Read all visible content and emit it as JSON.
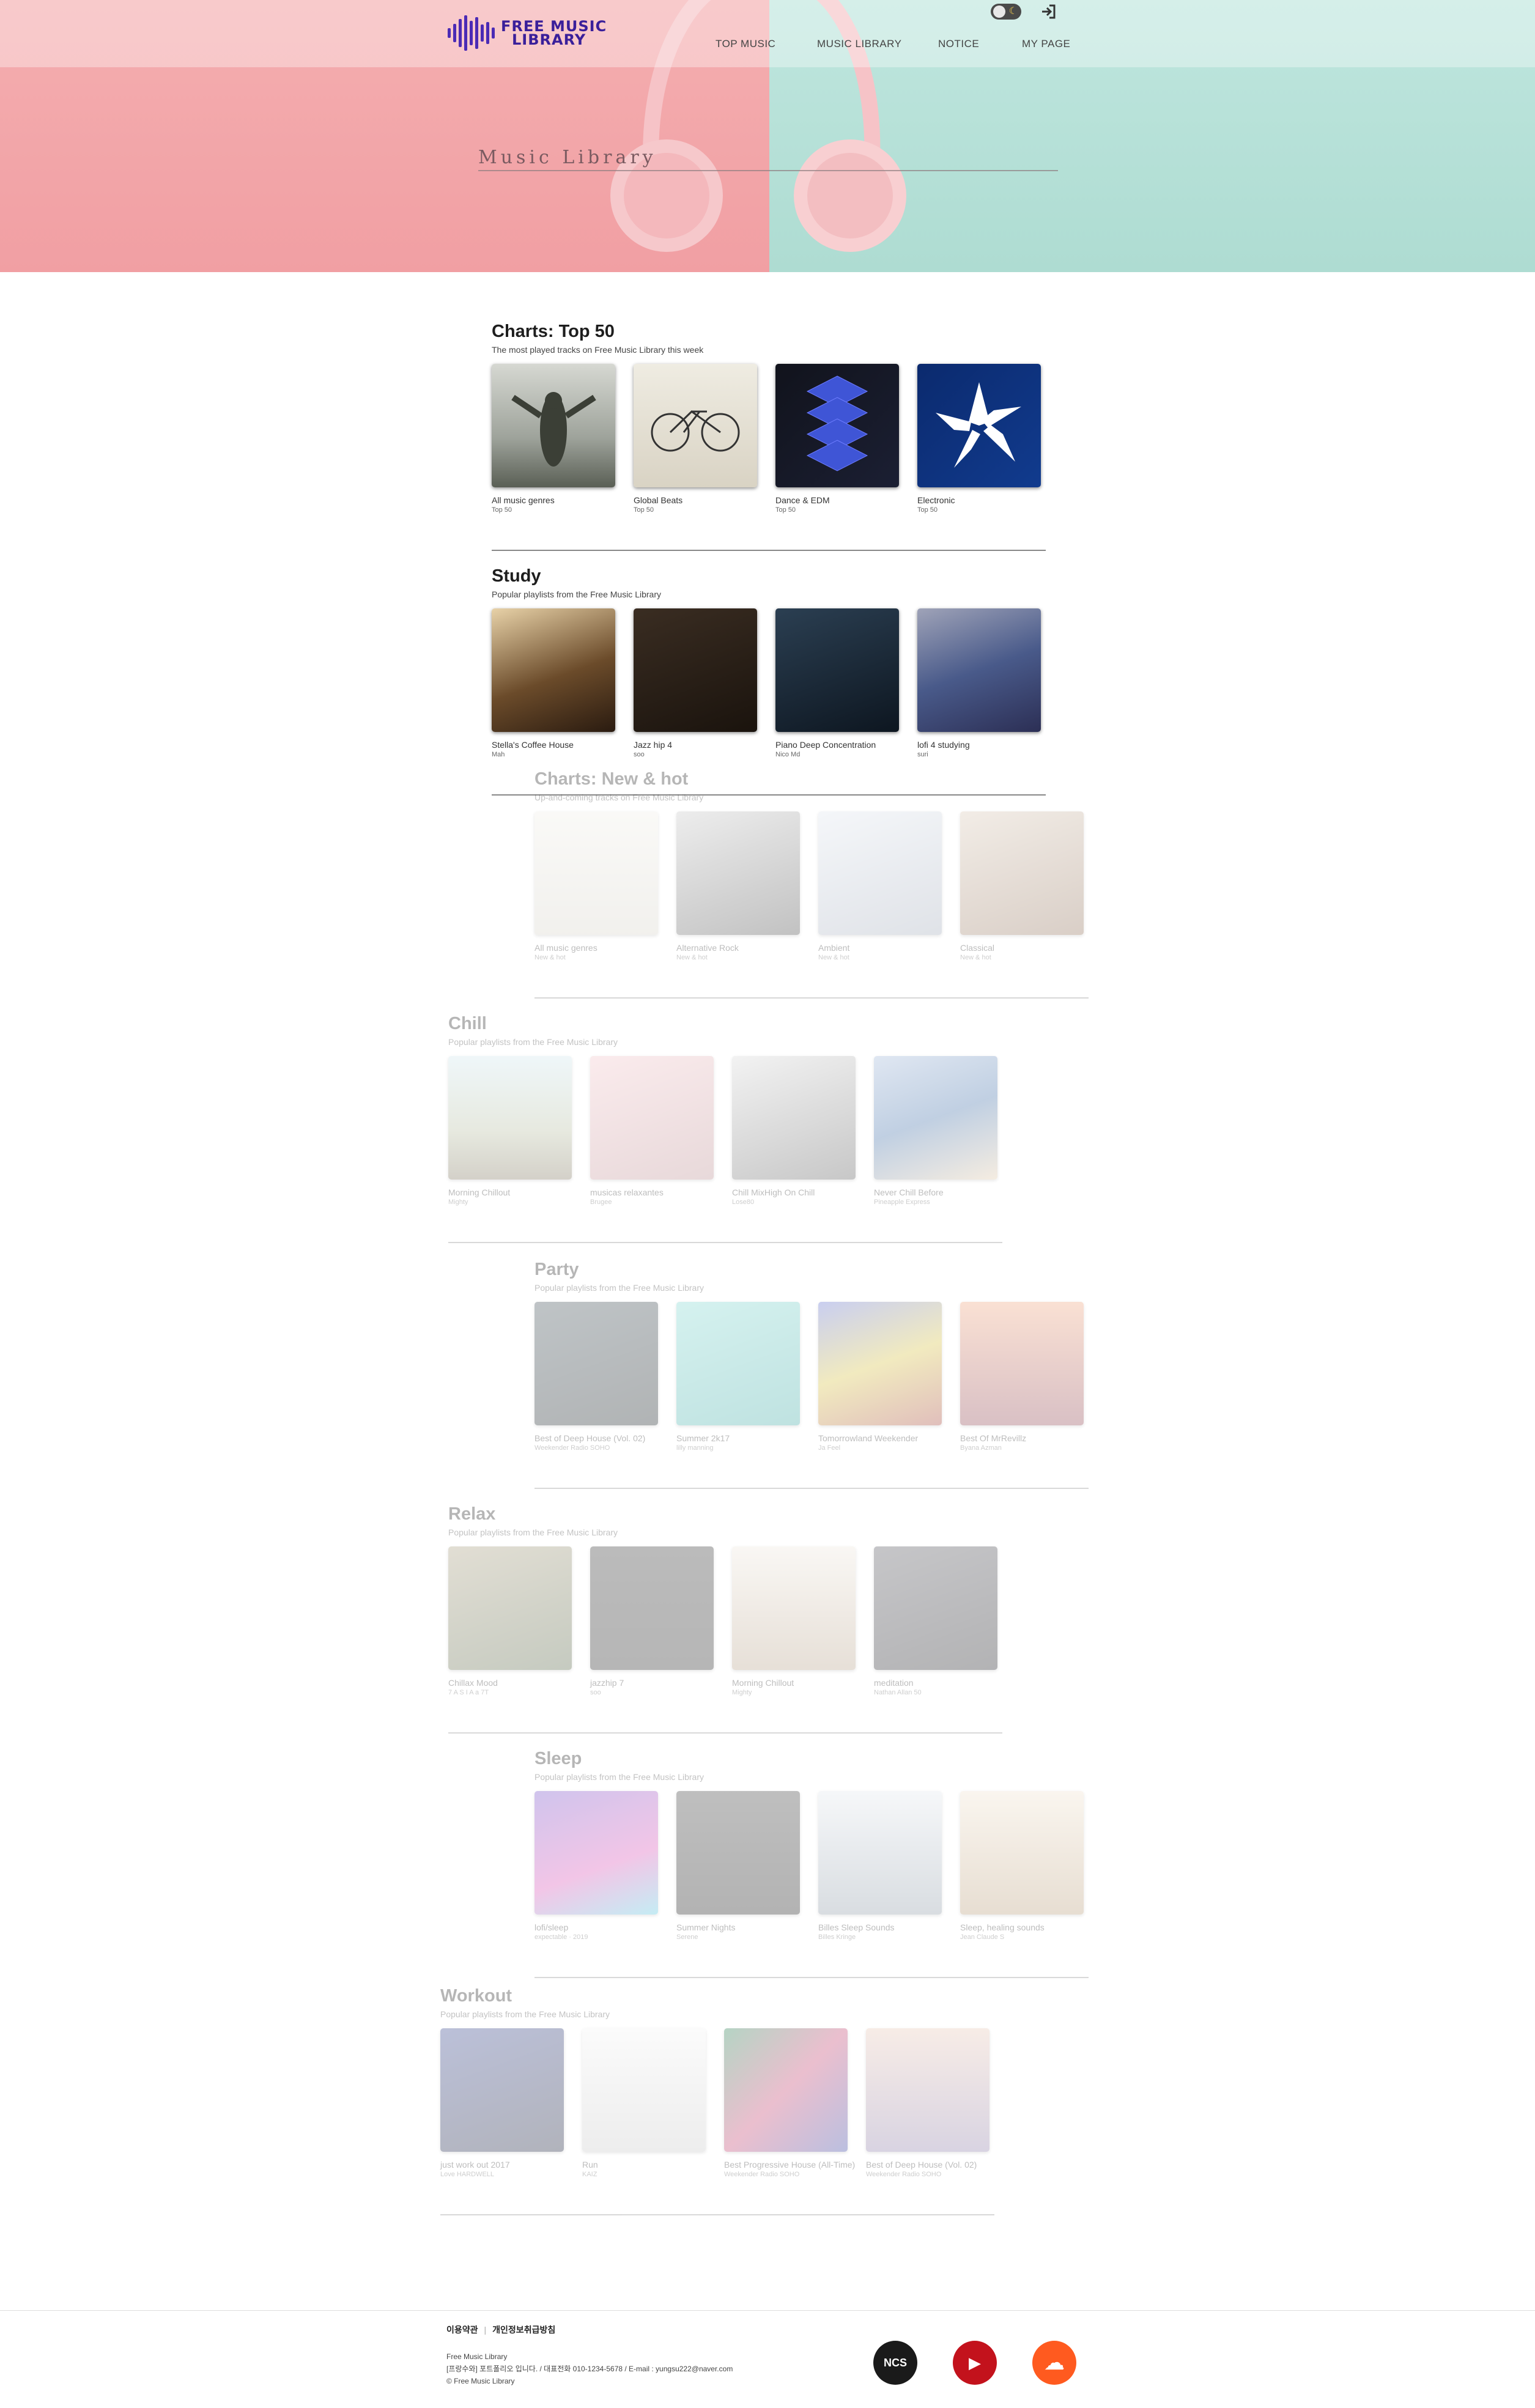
{
  "header": {
    "logo_line1": "FREE MUSIC",
    "logo_line2": "LIBRARY",
    "nav": [
      "TOP MUSIC",
      "MUSIC LIBRARY",
      "NOTICE",
      "MY PAGE"
    ]
  },
  "hero": {
    "title": "Music Library"
  },
  "sections": [
    {
      "title": "Charts: Top 50",
      "subtitle": "The most played tracks on Free Music Library this week",
      "items": [
        {
          "title": "All music genres",
          "sub": "Top 50"
        },
        {
          "title": "Global Beats",
          "sub": "Top 50"
        },
        {
          "title": "Dance & EDM",
          "sub": "Top 50"
        },
        {
          "title": "Electronic",
          "sub": "Top 50"
        }
      ]
    },
    {
      "title": "Study",
      "subtitle": "Popular playlists from the Free Music Library",
      "items": [
        {
          "title": "Stella's Coffee House",
          "sub": "Mah"
        },
        {
          "title": "Jazz hip 4",
          "sub": "soo"
        },
        {
          "title": "Piano Deep Concentration",
          "sub": "Nico Md"
        },
        {
          "title": "lofi 4 studying",
          "sub": "suri"
        }
      ]
    },
    {
      "title": "Charts: New & hot",
      "subtitle": "Up-and-coming tracks on Free Music Library",
      "items": [
        {
          "title": "All music genres",
          "sub": "New & hot"
        },
        {
          "title": "Alternative Rock",
          "sub": "New & hot"
        },
        {
          "title": "Ambient",
          "sub": "New & hot"
        },
        {
          "title": "Classical",
          "sub": "New & hot"
        }
      ]
    },
    {
      "title": "Chill",
      "subtitle": "Popular playlists from the Free Music Library",
      "items": [
        {
          "title": "Morning Chillout",
          "sub": "Mighty"
        },
        {
          "title": "musicas relaxantes",
          "sub": "Brugee"
        },
        {
          "title": "Chill MixHigh On Chill",
          "sub": "Lose80"
        },
        {
          "title": "Never Chill Before",
          "sub": "Pineapple Express"
        }
      ]
    },
    {
      "title": "Party",
      "subtitle": "Popular playlists from the Free Music Library",
      "items": [
        {
          "title": "Best of Deep House (Vol. 02)",
          "sub": "Weekender Radio SOHO"
        },
        {
          "title": "Summer 2k17",
          "sub": "lilly manning"
        },
        {
          "title": "Tomorrowland Weekender",
          "sub": "Ja Feel"
        },
        {
          "title": "Best Of MrRevillz",
          "sub": "Byana Azman"
        }
      ]
    },
    {
      "title": "Relax",
      "subtitle": "Popular playlists from the Free Music Library",
      "items": [
        {
          "title": "Chillax Mood",
          "sub": "7 A S I A a 7T"
        },
        {
          "title": "jazzhip 7",
          "sub": "soo"
        },
        {
          "title": "Morning Chillout",
          "sub": "Mighty"
        },
        {
          "title": "meditation",
          "sub": "Nathan Allan 50"
        }
      ]
    },
    {
      "title": "Sleep",
      "subtitle": "Popular playlists from the Free Music Library",
      "items": [
        {
          "title": "lofi/sleep",
          "sub": "expectable · 2019"
        },
        {
          "title": "Summer Nights",
          "sub": "Serene"
        },
        {
          "title": "Billes Sleep Sounds",
          "sub": "Billes Kringe"
        },
        {
          "title": "Sleep, healing sounds",
          "sub": "Jean Claude S"
        }
      ]
    },
    {
      "title": "Workout",
      "subtitle": "Popular playlists from the Free Music Library",
      "items": [
        {
          "title": "just work out 2017",
          "sub": "Love HARDWELL"
        },
        {
          "title": "Run",
          "sub": "KAIZ"
        },
        {
          "title": "Best Progressive House (All-Time)",
          "sub": "Weekender Radio SOHO"
        },
        {
          "title": "Best of Deep House (Vol. 02)",
          "sub": "Weekender Radio SOHO"
        }
      ]
    }
  ],
  "thumb_art": {
    "Charts: Top 50": [
      {
        "bg": "linear-gradient(180deg,#d6d8d2,#9ea39b 60%,#5a5f55)"
      },
      {
        "bg": "linear-gradient(180deg,#efece2,#d9d3c4)"
      },
      {
        "bg": "linear-gradient(135deg,#11131c,#1b1f33)"
      },
      {
        "bg": "linear-gradient(135deg,#0b2a6e,#113b8e)"
      }
    ],
    "Study": [
      {
        "bg": "linear-gradient(160deg,#e8d2a8,#6b4b2a 55%,#2a1b10)"
      },
      {
        "bg": "linear-gradient(160deg,#3a2d22,#1a130d)"
      },
      {
        "bg": "linear-gradient(160deg,#2b3f52,#0d1620)"
      },
      {
        "bg": "linear-gradient(160deg,#9fa3b8,#495a8a 50%,#2c2f55)"
      }
    ],
    "Charts: New & hot": [
      {
        "bg": "linear-gradient(180deg,#f1efe8,#d6d3c9)"
      },
      {
        "bg": "linear-gradient(160deg,#c8c8c8,#444)"
      },
      {
        "bg": "linear-gradient(160deg,#e0e6ef,#9fa8b8)"
      },
      {
        "bg": "linear-gradient(160deg,#d8c7b4,#8c6b53)"
      }
    ],
    "Chill": [
      {
        "bg": "linear-gradient(180deg,#cfe7ee,#b6bea0 60%,#7b7159)"
      },
      {
        "bg": "linear-gradient(160deg,#f3c3c8,#b98a8e)"
      },
      {
        "bg": "linear-gradient(160deg,#d9d9d9,#555)"
      },
      {
        "bg": "linear-gradient(160deg,#9fb6d8,#3f6ea8 50%,#e0c7a4)"
      }
    ],
    "Party": [
      {
        "bg": "linear-gradient(160deg,#3b4a52,#0e171b)"
      },
      {
        "bg": "linear-gradient(160deg,#7fd7d0,#3aa7a2)"
      },
      {
        "bg": "linear-gradient(160deg,#5a6bd1,#d6c03b 50%,#a23a31)"
      },
      {
        "bg": "linear-gradient(180deg,#f0a27a,#8b3e4c)"
      }
    ],
    "Relax": [
      {
        "bg": "linear-gradient(160deg,#a69b7b,#4f5e3e)"
      },
      {
        "bg": "linear-gradient(180deg,#2f2f2f,#1f1f1f)"
      },
      {
        "bg": "linear-gradient(180deg,#efe8de,#b59f86)"
      },
      {
        "bg": "linear-gradient(160deg,#505058,#15151a)"
      }
    ],
    "Sleep": [
      {
        "bg": "linear-gradient(160deg,#6f4bc8,#d84fb6 60%,#4cc6de)"
      },
      {
        "bg": "linear-gradient(180deg,#3a3a3a,#151515)"
      },
      {
        "bg": "linear-gradient(180deg,#e4e9ef,#8a97a4)"
      },
      {
        "bg": "linear-gradient(180deg,#f1e3cf,#b79a75)"
      }
    ],
    "Workout": [
      {
        "bg": "linear-gradient(160deg,#2f3e8a,#101630)"
      },
      {
        "bg": "linear-gradient(180deg,#f4f4f4,#c9c9c9)"
      },
      {
        "bg": "linear-gradient(135deg,#1c7b4a,#c23a6a 50%,#2d3aa0)"
      },
      {
        "bg": "linear-gradient(180deg,#e8c6b4,#8a7aa6)"
      }
    ]
  },
  "footer": {
    "terms": "이용약관",
    "privacy": "개인정보취급방침",
    "info_line1": "Free Music Library",
    "info_line2": "[프랑수와] 포트폴리오 입니다. / 대표전화 010-1234-5678 / E-mail : yungsu222@naver.com",
    "info_line3": "© Free Music Library",
    "social": [
      {
        "name": "ncs",
        "label": "NCS",
        "color": "#1a1a1a"
      },
      {
        "name": "youtube-music",
        "label": "▶",
        "color": "#c3121c"
      },
      {
        "name": "soundcloud",
        "label": "☁",
        "color": "#ff5a1f"
      }
    ]
  }
}
